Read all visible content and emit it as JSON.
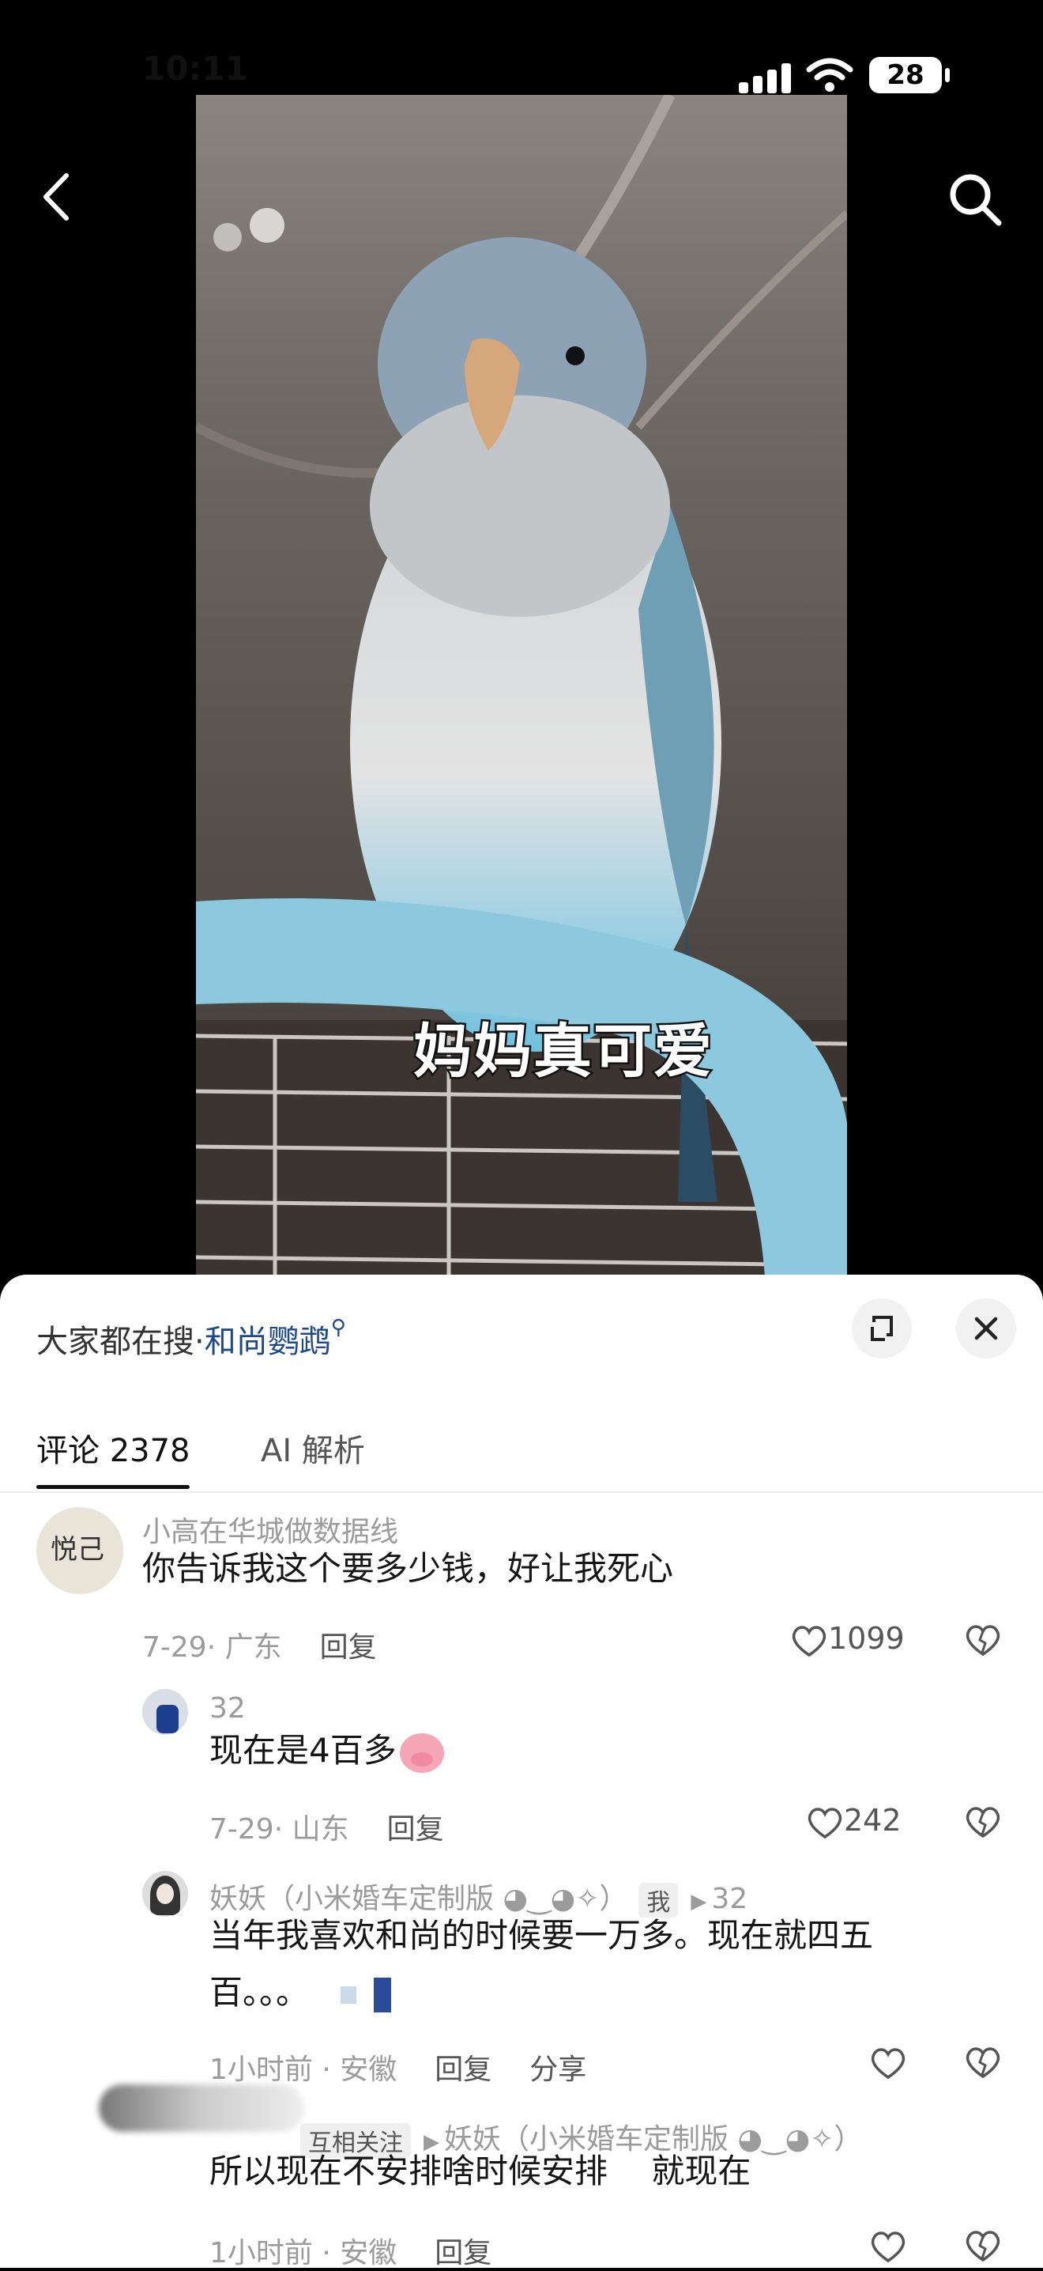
{
  "status_bar": {
    "time": "10:11",
    "battery": "28"
  },
  "video": {
    "caption": "妈妈真可爱"
  },
  "search_hint": {
    "prefix": "大家都在搜·",
    "keyword": "和尚鹦鹉"
  },
  "tabs": [
    {
      "label": "评论 2378"
    },
    {
      "label": "AI 解析"
    }
  ],
  "comments": [
    {
      "user": "小高在华城做数据线",
      "text": "你告诉我这个要多少钱，好让我死心",
      "meta": "7-29· 广东",
      "reply": "回复",
      "likes": "1099",
      "avatar_text": "悦己"
    },
    {
      "user": "32",
      "text": "现在是4百多",
      "meta": "7-29· 山东",
      "reply": "回复",
      "likes": "242"
    },
    {
      "user": "妖妖（小米婚车定制版 ◕‿◕✧）",
      "me_badge": "我",
      "reply_to": "32",
      "text_line1": "当年我喜欢和尚的时候要一万多。现在就四五",
      "text_line2": "百。。。",
      "meta": "1小时前 · 安徽",
      "reply": "回复",
      "share": "分享"
    },
    {
      "badge": "互相关注",
      "reply_to": "妖妖（小米婚车定制版 ◕‿◕✧）",
      "text": "所以现在不安排啥时候安排　 就现在",
      "meta": "1小时前 · 安徽",
      "reply": "回复"
    }
  ]
}
